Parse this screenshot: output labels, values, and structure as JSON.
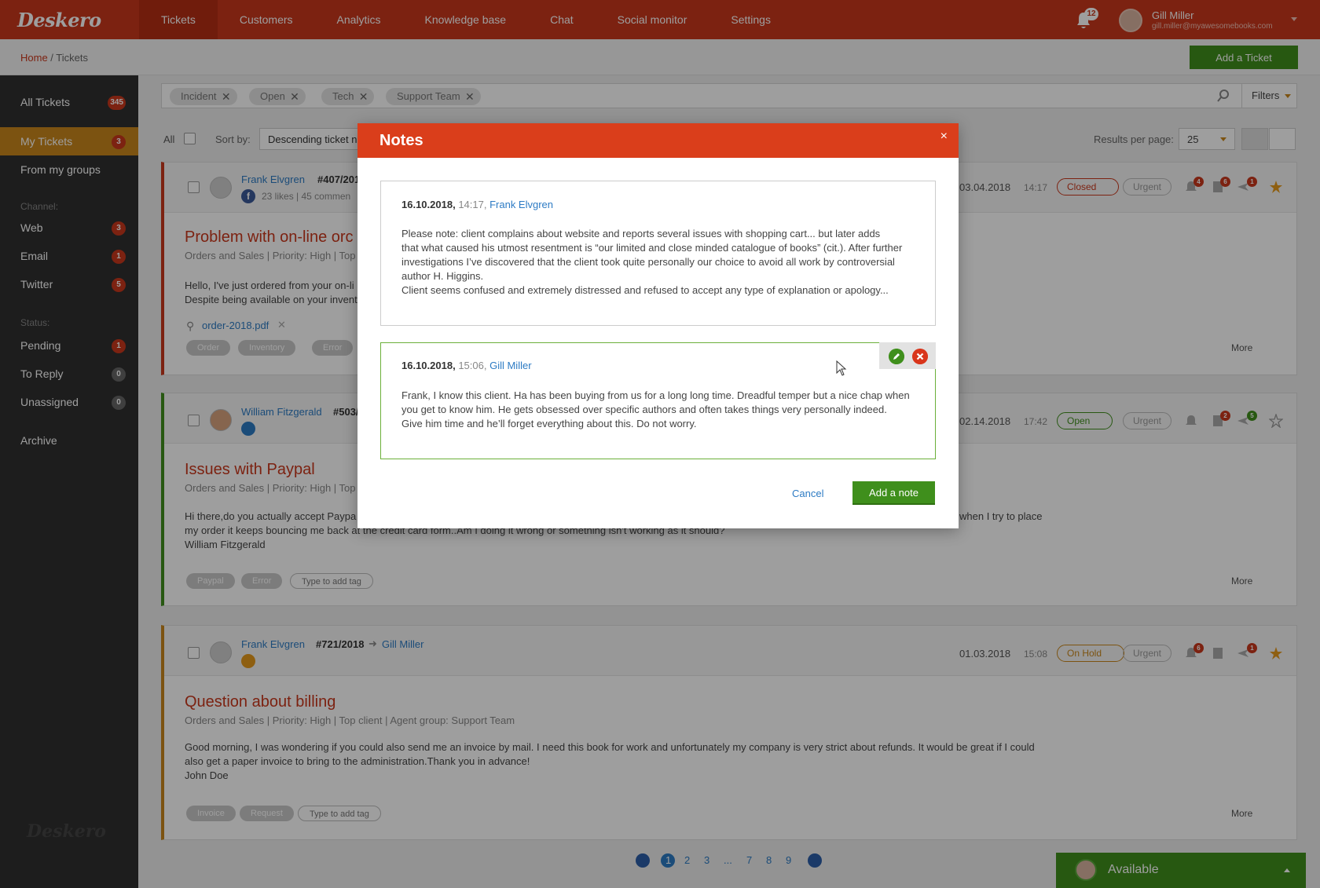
{
  "app": {
    "logo": "Deskero",
    "nav": [
      "Tickets",
      "Customers",
      "Analytics",
      "Knowledge base",
      "Chat",
      "Social monitor",
      "Settings"
    ],
    "notifications_count": "12",
    "user": {
      "name": "Gill Miller",
      "email": "gill.miller@myawesomebooks.com"
    }
  },
  "breadcrumb": {
    "home": "Home",
    "separator": " / ",
    "current": "Tickets"
  },
  "add_ticket_label": "Add a Ticket",
  "sidebar": {
    "items": [
      {
        "label": "All Tickets",
        "count": "345"
      },
      {
        "label": "My Tickets",
        "count": "3"
      },
      {
        "label": "From my groups",
        "count": ""
      }
    ],
    "channel_label": "Channel:",
    "channels": [
      {
        "label": "Web",
        "count": "3"
      },
      {
        "label": "Email",
        "count": "1"
      },
      {
        "label": "Twitter",
        "count": "5"
      }
    ],
    "status_label": "Status:",
    "statuses": [
      {
        "label": "Pending",
        "count": "1"
      },
      {
        "label": "To Reply",
        "count": "0"
      },
      {
        "label": "Unassigned",
        "count": "0"
      }
    ],
    "archive": "Archive",
    "footer_logo": "Deskero"
  },
  "filters": {
    "chips": [
      "Incident",
      "Open",
      "Tech",
      "Support Team"
    ],
    "button": "Filters"
  },
  "toolbar": {
    "all_label": "All",
    "sort_label": "Sort by:",
    "sort_value": "Descending ticket n",
    "rpp_label": "Results per page:",
    "rpp_value": "25"
  },
  "tickets": [
    {
      "author": "Frank Elvgren",
      "number": "#407/201",
      "social": "23 likes | 45 commen",
      "title": "Problem with on-line orc",
      "sub": "Orders and Sales | Priority: High | Top",
      "body1": "Hello, I've just ordered from your on-li",
      "body2": "Despite being available on your invent",
      "attachment": "order-2018.pdf",
      "tags": [
        "Order",
        "Inventory",
        "Error"
      ],
      "date": "03.04.2018",
      "time": "14:17",
      "status": "Closed",
      "priority": "Urgent",
      "badges": [
        "4",
        "6",
        "1"
      ],
      "more": "More"
    },
    {
      "author": "William Fitzgerald",
      "number": "#503/",
      "title": "Issues with Paypal",
      "sub": "Orders and Sales | Priority: High | Top",
      "body1": "Hi there,do you actually accept Paypa",
      "body1b": "when I try to place",
      "body2": "my order it keeps bouncing me back at the credit card form..Am I doing it wrong or something isn't working as it should?",
      "body3": "William Fitzgerald",
      "tags": [
        "Paypal",
        "Error"
      ],
      "tag_input": "Type to add tag",
      "date": "02.14.2018",
      "time": "17:42",
      "status": "Open",
      "priority": "Urgent",
      "badges": [
        "2",
        "5"
      ],
      "more": "More"
    },
    {
      "author": "Frank Elvgren",
      "number": "#721/2018",
      "agent": "Gill Miller",
      "title": "Question about billing",
      "sub": "Orders and Sales | Priority: High | Top client | Agent group: Support Team",
      "body1": "Good morning, I was wondering if you could also send me an invoice by mail. I need this book for work and unfortunately my company is very strict about refunds. It would be great if I could",
      "body2": "also get a paper invoice to bring to the administration.Thank you in advance!",
      "body3": "John Doe",
      "tags": [
        "Invoice",
        "Request"
      ],
      "tag_input": "Type to add tag",
      "date": "01.03.2018",
      "time": "15:08",
      "status": "On Hold",
      "priority": "Urgent",
      "badges": [
        "6",
        "1"
      ],
      "more": "More"
    }
  ],
  "pagination": [
    "1",
    "2",
    "3",
    "...",
    "7",
    "8",
    "9"
  ],
  "availability": "Available",
  "modal": {
    "title": "Notes",
    "close": "×",
    "notes": [
      {
        "date": "16.10.2018,",
        "time": "14:17,",
        "author": "Frank Elvgren",
        "lines": [
          "Please note: client complains about website and reports several issues with shopping cart... but later adds",
          "that what caused his utmost resentment is “our limited and close minded catalogue of books” (cit.). After further",
          "investigations I’ve discovered that the client took quite personally our choice to avoid all work by controversial",
          "author H. Higgins.",
          "Client seems confused and extremely distressed and refused to accept any type of explanation or apology..."
        ]
      },
      {
        "date": "16.10.2018,",
        "time": "15:06,",
        "author": "Gill Miller",
        "lines": [
          "Frank, I know this client. Ha has been buying from us for a long long time. Dreadful temper but a nice chap when",
          "you get to know him. He gets obsessed over specific authors and often takes things very personally indeed.",
          "Give him time and he’ll forget everything about this. Do not worry."
        ]
      }
    ],
    "cancel": "Cancel",
    "add_note": "Add a note"
  },
  "colors": {
    "brand": "#c9371c",
    "accent_green": "#3f8f1c",
    "sidebar_active": "#c9871c",
    "link": "#2d7bc4"
  }
}
